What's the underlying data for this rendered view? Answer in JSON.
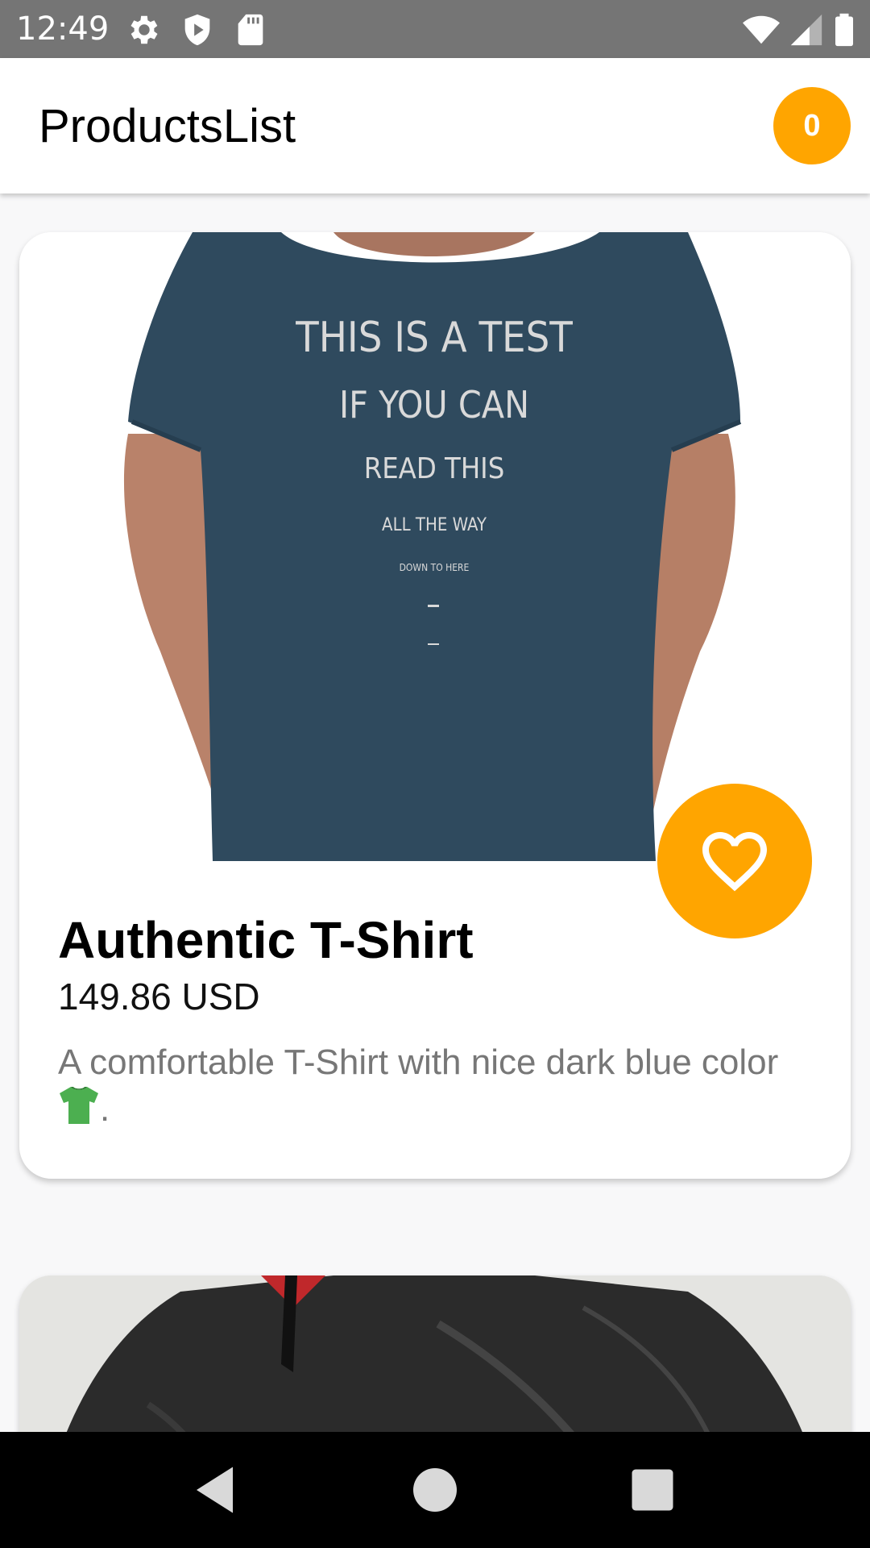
{
  "status_bar": {
    "time": "12:49",
    "icons": [
      "settings-icon",
      "play-protect-icon",
      "sd-card-icon",
      "wifi-icon",
      "signal-icon",
      "battery-icon"
    ]
  },
  "app_bar": {
    "title": "ProductsList",
    "cart_count": "0"
  },
  "products": [
    {
      "image": "dark blue t-shirt photo",
      "shirt_print": [
        "THIS IS A TEST",
        "IF YOU CAN",
        "READ THIS",
        "ALL THE WAY",
        "DOWN TO HERE"
      ],
      "name": "Authentic T-Shirt",
      "price": "149.86 USD",
      "description": "A comfortable T-Shirt with nice dark blue color",
      "description_suffix": ".",
      "favorite_icon": "heart-outline-icon"
    },
    {
      "image": "black jacket photo"
    }
  ],
  "navigation": {
    "icons": [
      "back-icon",
      "home-icon",
      "recents-icon"
    ]
  },
  "colors": {
    "accent": "#FFA500",
    "status_bar": "#757575",
    "shirt": "#2F4A5E"
  }
}
